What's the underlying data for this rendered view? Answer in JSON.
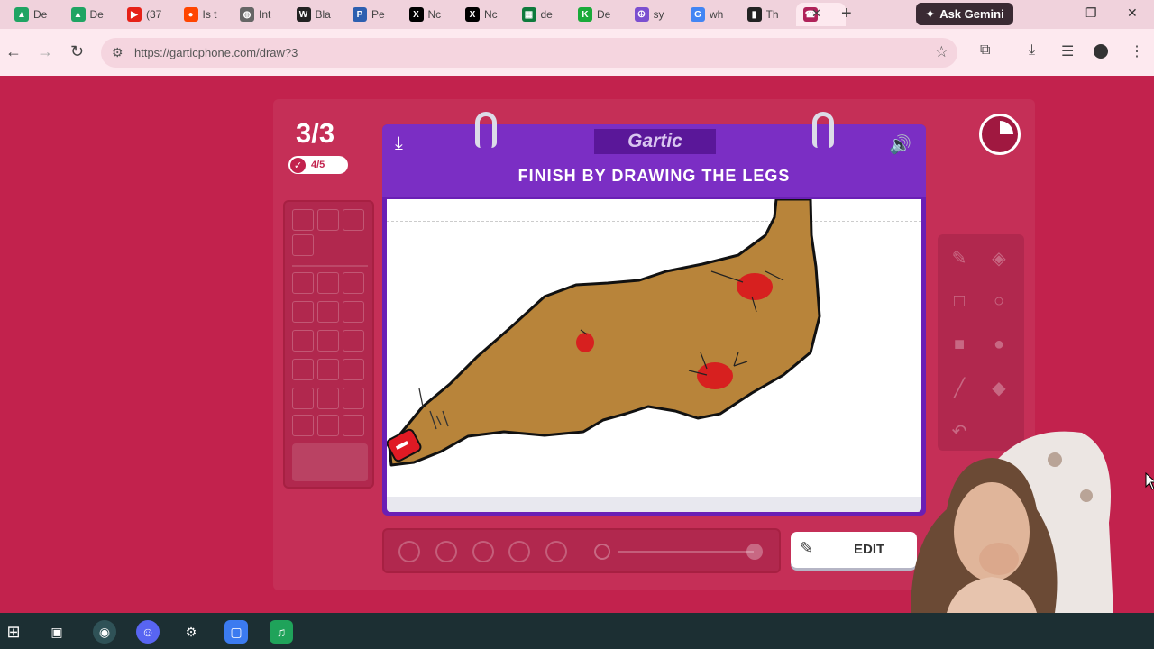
{
  "browser": {
    "tabs": [
      {
        "title": "De",
        "icon": "google-drive-icon",
        "color": "#1fa463"
      },
      {
        "title": "De",
        "icon": "google-drive-icon",
        "color": "#1fa463"
      },
      {
        "title": "(37",
        "icon": "youtube-icon",
        "color": "#e62117"
      },
      {
        "title": "Is t",
        "icon": "reddit-icon",
        "color": "#ff4500"
      },
      {
        "title": "Int",
        "icon": "globe-icon",
        "color": "#666666"
      },
      {
        "title": "Bla",
        "icon": "wix-icon",
        "color": "#222222"
      },
      {
        "title": "Pe",
        "icon": "news-icon",
        "color": "#2d5fb0"
      },
      {
        "title": "Nc",
        "icon": "x-icon",
        "color": "#000000"
      },
      {
        "title": "Nc",
        "icon": "x-icon",
        "color": "#000000"
      },
      {
        "title": "de",
        "icon": "spreadsheet-icon",
        "color": "#0f7b3d"
      },
      {
        "title": "De",
        "icon": "k-icon",
        "color": "#1aaa3a"
      },
      {
        "title": "sy",
        "icon": "peace-icon",
        "color": "#7b4fd0"
      },
      {
        "title": "wh",
        "icon": "google-icon",
        "color": "#4285f4"
      },
      {
        "title": "Th",
        "icon": "terminal-icon",
        "color": "#222222"
      },
      {
        "title": "",
        "icon": "gartic-icon",
        "color": "#b0235a"
      }
    ],
    "gemini_label": "Ask Gemini",
    "url": "https://garticphone.com/draw?3"
  },
  "game": {
    "round": "3/3",
    "progress": "4/5",
    "logo": "Gartic",
    "instruction": "FINISH BY DRAWING THE LEGS",
    "edit_label": "EDIT",
    "timer_fraction": 0.25
  },
  "colors": {
    "body": "#b8843a",
    "spots": "#d7201f",
    "tip": "#e01a24",
    "background": "#c2224d",
    "frame": "#6a1fb5"
  }
}
